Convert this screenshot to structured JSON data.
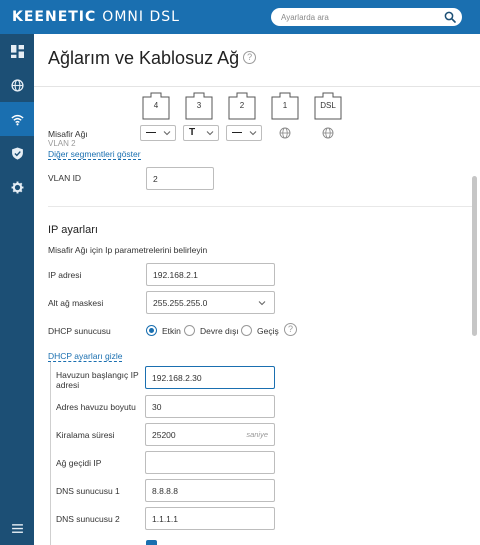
{
  "header": {
    "brand": "KEENETIC",
    "model": "OMNI DSL",
    "search_placeholder": "Ayarlarda ara"
  },
  "sidebar": {
    "items": [
      {
        "icon": "dashboard-icon",
        "active": false
      },
      {
        "icon": "globe-icon",
        "active": false
      },
      {
        "icon": "wifi-icon",
        "active": true
      },
      {
        "icon": "shield-icon",
        "active": false
      },
      {
        "icon": "gear-icon",
        "active": false
      }
    ],
    "bottom_icon": "menu-icon"
  },
  "page": {
    "title": "Ağlarım ve Kablosuz Ağ",
    "help": "?"
  },
  "ports": [
    "4",
    "3",
    "2",
    "1",
    "DSL"
  ],
  "segment": {
    "label": "Misafir Ağı",
    "vlan": "VLAN 2",
    "show_other_link": "Diğer segmentleri göster",
    "port_modes": [
      "—",
      "T",
      "—"
    ]
  },
  "vlan": {
    "label": "VLAN ID",
    "value": "2"
  },
  "ip": {
    "section_title": "IP ayarları",
    "description": "Misafir Ağı için Ip parametrelerini belirleyin",
    "address_label": "IP adresi",
    "address_value": "192.168.2.1",
    "mask_label": "Alt ağ maskesi",
    "mask_value": "255.255.255.0"
  },
  "dhcp": {
    "label": "DHCP sunucusu",
    "options": [
      "Etkin",
      "Devre dışı",
      "Geçiş"
    ],
    "selected": "Etkin",
    "hide_link": "DHCP ayarları gizle",
    "pool_start_label": "Havuzun başlangıç IP adresi",
    "pool_start_value": "192.168.2.30",
    "pool_size_label": "Adres havuzu boyutu",
    "pool_size_value": "30",
    "lease_label": "Kiralama süresi",
    "lease_value": "25200",
    "lease_unit": "saniye",
    "gateway_label": "Ağ geçidi IP",
    "gateway_value": "",
    "dns1_label": "DNS sunucusu 1",
    "dns1_value": "8.8.8.8",
    "dns2_label": "DNS sunucusu 2",
    "dns2_value": "1.1.1.1"
  },
  "colors": {
    "header_blue": "#1a6fb0",
    "sidebar_navy": "#1c4f75",
    "link_blue": "#1a6fb0"
  }
}
